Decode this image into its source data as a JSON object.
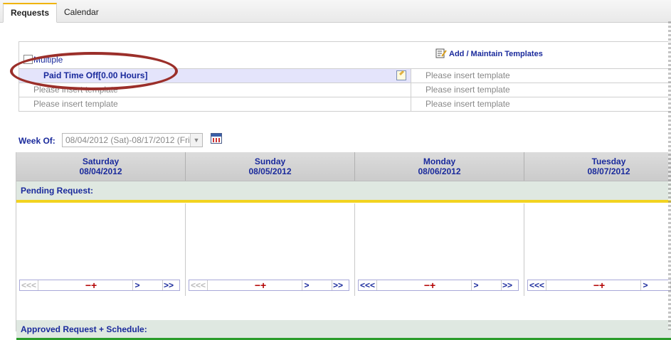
{
  "tabs": [
    {
      "label": "Requests",
      "active": true
    },
    {
      "label": "Calendar",
      "active": false
    }
  ],
  "templates": {
    "multiple_label": "Multiple",
    "add_label": "Add / Maintain Templates",
    "rows": [
      {
        "left": "Paid Time Off[0.00 Hours]",
        "right": "Please insert template"
      },
      {
        "left": "Please insert template",
        "right": "Please insert template"
      },
      {
        "left": "Please insert template",
        "right": "Please insert template"
      }
    ]
  },
  "week": {
    "label": "Week Of:",
    "value": "08/04/2012 (Sat)-08/17/2012 (Fri)"
  },
  "days": [
    {
      "name": "Saturday",
      "date": "08/04/2012"
    },
    {
      "name": "Sunday",
      "date": "08/05/2012"
    },
    {
      "name": "Monday",
      "date": "08/06/2012"
    },
    {
      "name": "Tuesday",
      "date": "08/07/2012"
    }
  ],
  "sections": {
    "pending": "Pending Request:",
    "approved": "Approved Request + Schedule:"
  },
  "pager": {
    "first": "<<",
    "prev": "<",
    "minus_plus": "−+",
    "next": ">",
    "last": ">>"
  },
  "colors": {
    "link_blue": "#1a2a9c",
    "selected_row_bg": "#e4e4fb",
    "pending_line": "#f2d320",
    "approved_line": "#2a9c2a",
    "annotation_oval": "#9b2f2a"
  }
}
